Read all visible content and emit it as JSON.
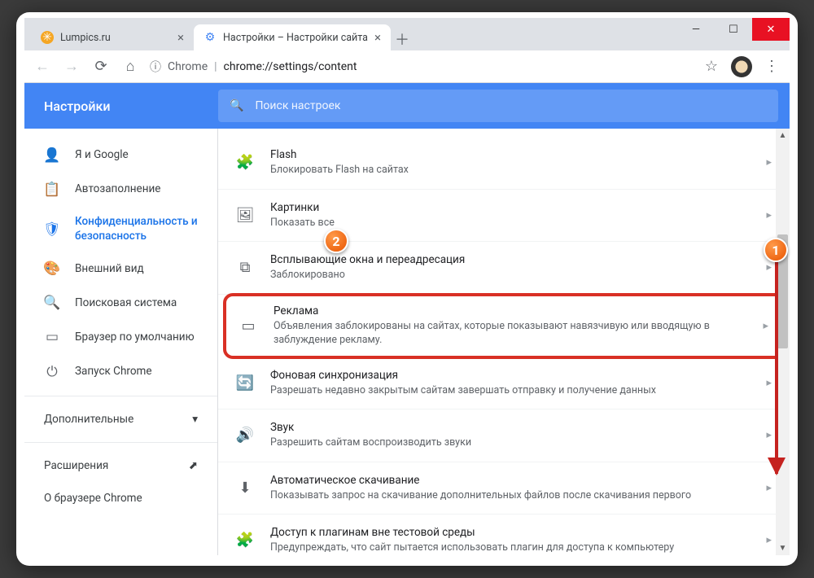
{
  "window": {
    "tabs": [
      {
        "title": "Lumpics.ru",
        "favicon_color": "#f5a623",
        "active": false
      },
      {
        "title": "Настройки – Настройки сайта",
        "favicon_color": "#4285f4",
        "active": true
      }
    ]
  },
  "toolbar": {
    "url_prefix": "Chrome",
    "url_path": "chrome://settings/content"
  },
  "header": {
    "title": "Настройки",
    "search_placeholder": "Поиск настроек"
  },
  "sidebar": {
    "items": [
      {
        "icon": "person",
        "label": "Я и Google"
      },
      {
        "icon": "clipboard",
        "label": "Автозаполнение"
      },
      {
        "icon": "shield",
        "label": "Конфиденциальность и безопасность",
        "active": true
      },
      {
        "icon": "palette",
        "label": "Внешний вид"
      },
      {
        "icon": "search",
        "label": "Поисковая система"
      },
      {
        "icon": "browser",
        "label": "Браузер по умолчанию"
      },
      {
        "icon": "power",
        "label": "Запуск Chrome"
      }
    ],
    "advanced_label": "Дополнительные",
    "links": [
      {
        "label": "Расширения",
        "external": true
      },
      {
        "label": "О браузере Chrome",
        "external": false
      }
    ]
  },
  "content_settings": [
    {
      "icon": "puzzle",
      "title": "Flash",
      "sub": "Блокировать Flash на сайтах"
    },
    {
      "icon": "image",
      "title": "Картинки",
      "sub": "Показать все"
    },
    {
      "icon": "popup",
      "title": "Всплывающие окна и переадресация",
      "sub": "Заблокировано"
    },
    {
      "icon": "ad",
      "title": "Реклама",
      "sub": "Объявления заблокированы на сайтах, которые показывают навязчивую или вводящую в заблуждение рекламу.",
      "highlighted": true
    },
    {
      "icon": "sync",
      "title": "Фоновая синхронизация",
      "sub": "Разрешать недавно закрытым сайтам завершать отправку и получение данных"
    },
    {
      "icon": "sound",
      "title": "Звук",
      "sub": "Разрешить сайтам воспроизводить звуки"
    },
    {
      "icon": "download",
      "title": "Автоматическое скачивание",
      "sub": "Показывать запрос на скачивание дополнительных файлов после скачивания первого"
    },
    {
      "icon": "plugin",
      "title": "Доступ к плагинам вне тестовой среды",
      "sub": "Предупреждать, что сайт пытается использовать плагин для доступа к компьютеру"
    }
  ],
  "markers": {
    "one": "1",
    "two": "2"
  },
  "icon_glyphs": {
    "person": "👤",
    "clipboard": "📋",
    "shield": "🛡",
    "palette": "🎨",
    "search": "🔍",
    "browser": "▭",
    "power": "⏻",
    "puzzle": "🧩",
    "image": "🖼",
    "popup": "⧉",
    "ad": "▭",
    "sync": "🔄",
    "sound": "🔊",
    "download": "⬇",
    "plugin": "🧩",
    "chevron": "▸",
    "chevron_down": "▾",
    "external": "⬈"
  }
}
